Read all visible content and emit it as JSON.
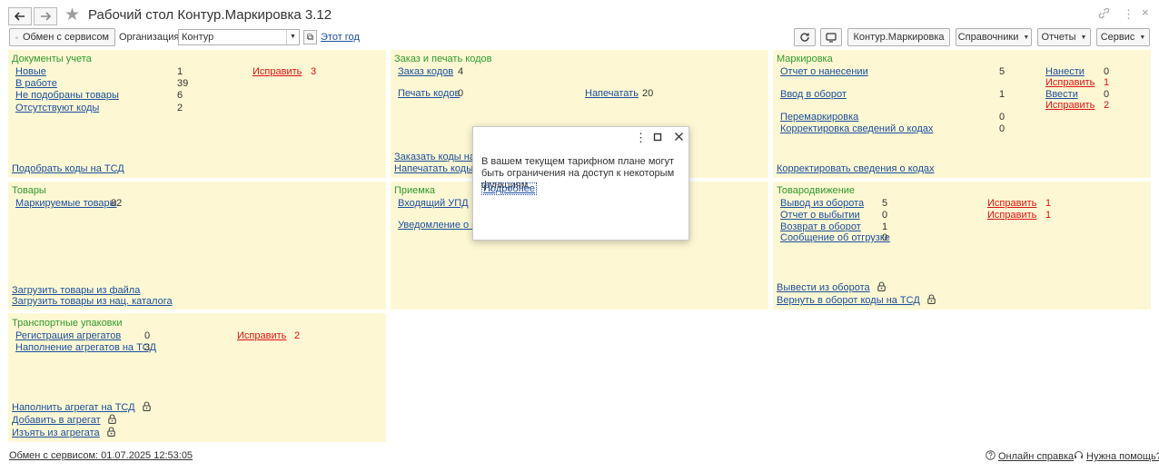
{
  "window": {
    "title": "Рабочий стол Контур.Маркировка 3.12"
  },
  "toolbar": {
    "exchange_button": "Обмен с сервисом",
    "org_label": "Организация:",
    "org_value": "Контур",
    "this_year_link": "Этот год",
    "kontur_button": "Контур.Маркировка",
    "directories_button": "Справочники",
    "reports_button": "Отчеты",
    "service_button": "Сервис"
  },
  "panels": {
    "accounting": {
      "title": "Документы учета",
      "rows": [
        {
          "label": "Новые",
          "value": "1"
        },
        {
          "label": "В работе",
          "value": "39"
        },
        {
          "label": "Не подобраны товары",
          "value": "6"
        },
        {
          "label": "Отсутствуют коды",
          "value": "2"
        }
      ],
      "fix_label": "Исправить",
      "fix_value": "3",
      "bottom_link": "Подобрать коды на ТСД"
    },
    "orders": {
      "title": "Заказ и печать кодов",
      "order_codes": {
        "label": "Заказ кодов",
        "value": "4"
      },
      "print_codes": {
        "label": "Печать кодов",
        "value": "0"
      },
      "printed": {
        "label": "Напечатать",
        "value": "20"
      },
      "bottom_links": [
        "Заказать коды на ТСД",
        "Напечатать коды с ТСД"
      ]
    },
    "marking": {
      "title": "Маркировка",
      "rows": [
        {
          "label": "Отчет о нанесении",
          "value": "5"
        },
        {
          "label": "Ввод в оборот",
          "value": "1"
        },
        {
          "label": "Перемаркировка",
          "value": "0"
        },
        {
          "label": "Корректировка сведений о кодах",
          "value": "0"
        }
      ],
      "side": [
        {
          "label": "Нанести",
          "value": "0",
          "red": false
        },
        {
          "label": "Исправить",
          "value": "1",
          "red": true
        },
        {
          "label": "Ввести",
          "value": "0",
          "red": false
        },
        {
          "label": "Исправить",
          "value": "2",
          "red": true
        }
      ],
      "bottom_link": "Корректировать сведения о кодах"
    },
    "goods": {
      "title": "Товары",
      "row": {
        "label": "Маркируемые товары",
        "value": "82"
      },
      "bottom_links": [
        "Загрузить товары из файла",
        "Загрузить товары из нац. каталога"
      ]
    },
    "receiving": {
      "title": "Приемка",
      "rows": [
        "Входящий УПД",
        "Уведомление о приемке"
      ]
    },
    "movement": {
      "title": "Товародвижение",
      "rows": [
        {
          "label": "Вывод из оборота",
          "value": "5"
        },
        {
          "label": "Отчет о выбытии",
          "value": "0"
        },
        {
          "label": "Возврат в оборот",
          "value": "1"
        },
        {
          "label": "Сообщение об отгрузке",
          "value": "0"
        }
      ],
      "fixes": [
        {
          "label": "Исправить",
          "value": "1"
        },
        {
          "label": "Исправить",
          "value": "1"
        }
      ],
      "bottom_links": [
        "Вывести из оборота",
        "Вернуть в оборот коды на ТСД"
      ]
    },
    "transport": {
      "title": "Транспортные упаковки",
      "rows": [
        {
          "label": "Регистрация агрегатов",
          "value": "0"
        },
        {
          "label": "Наполнение агрегатов на ТСД",
          "value": "3"
        }
      ],
      "fix_label": "Исправить",
      "fix_value": "2",
      "bottom_links": [
        "Наполнить агрегат на ТСД",
        "Добавить в агрегат",
        "Изъять из агрегата"
      ]
    }
  },
  "modal": {
    "message": "В вашем текущем тарифном плане могут быть ограничения на доступ к некоторым функциям.",
    "link": "Подробнее"
  },
  "footer": {
    "exchange_status": "Обмен с сервисом: 01.07.2025 12:53:05",
    "online_help": "Онлайн справка",
    "need_help": "Нужна помощь?"
  },
  "icons": {
    "back": "arrow-left-icon",
    "forward": "arrow-right-icon",
    "favorite": "star-icon",
    "lock": "lock-icon"
  },
  "colors": {
    "panel_bg": "#fdf8d3",
    "panel_title": "#2f9a2f",
    "link": "#1c4fa0",
    "warning": "#e01010"
  }
}
